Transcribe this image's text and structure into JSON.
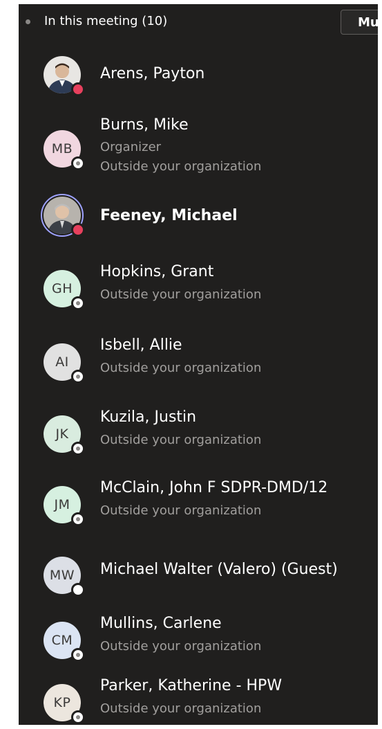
{
  "header": {
    "title": "In this meeting (10)",
    "mute_all_label": "Mute all"
  },
  "colors": {
    "panel_bg": "#201f1e",
    "busy_status": "#e7405d",
    "speaking_ring": "#9ea2ff",
    "secondary_text": "#a19f9d"
  },
  "participants": [
    {
      "name": "Arens, Payton",
      "initials": "",
      "avatar": "photo",
      "status": "busy-icon",
      "lines": []
    },
    {
      "name": "Burns, Mike",
      "initials": "MB",
      "avatar_color": "#f1d7e0",
      "status": "external-icon",
      "lines": [
        "Organizer",
        "Outside your organization"
      ]
    },
    {
      "name": "Feeney, Michael",
      "initials": "",
      "avatar": "photo",
      "status": "busy-icon",
      "speaking": true,
      "lines": []
    },
    {
      "name": "Hopkins, Grant",
      "initials": "GH",
      "avatar_color": "#d6f0e0",
      "status": "external-icon",
      "lines": [
        "Outside your organization"
      ]
    },
    {
      "name": "Isbell, Allie",
      "initials": "AI",
      "avatar_color": "#e1e1e1",
      "status": "external-icon",
      "lines": [
        "Outside your organization"
      ]
    },
    {
      "name": "Kuzila, Justin",
      "initials": "JK",
      "avatar_color": "#d9ecdf",
      "status": "external-icon",
      "lines": [
        "Outside your organization"
      ]
    },
    {
      "name": "McClain, John F SDPR-DMD/12",
      "initials": "JM",
      "avatar_color": "#d6f0e0",
      "status": "external-icon",
      "lines": [
        "Outside your organization"
      ]
    },
    {
      "name": "Michael Walter (Valero) (Guest)",
      "initials": "MW",
      "avatar_color": "#dcdfe6",
      "status": "guest-icon",
      "lines": []
    },
    {
      "name": "Mullins, Carlene",
      "initials": "CM",
      "avatar_color": "#dbe4f3",
      "status": "external-icon",
      "lines": [
        "Outside your organization"
      ]
    },
    {
      "name": "Parker, Katherine - HPW",
      "initials": "KP",
      "avatar_color": "#ece6de",
      "status": "external-icon",
      "lines": [
        "Outside your organization"
      ]
    }
  ]
}
